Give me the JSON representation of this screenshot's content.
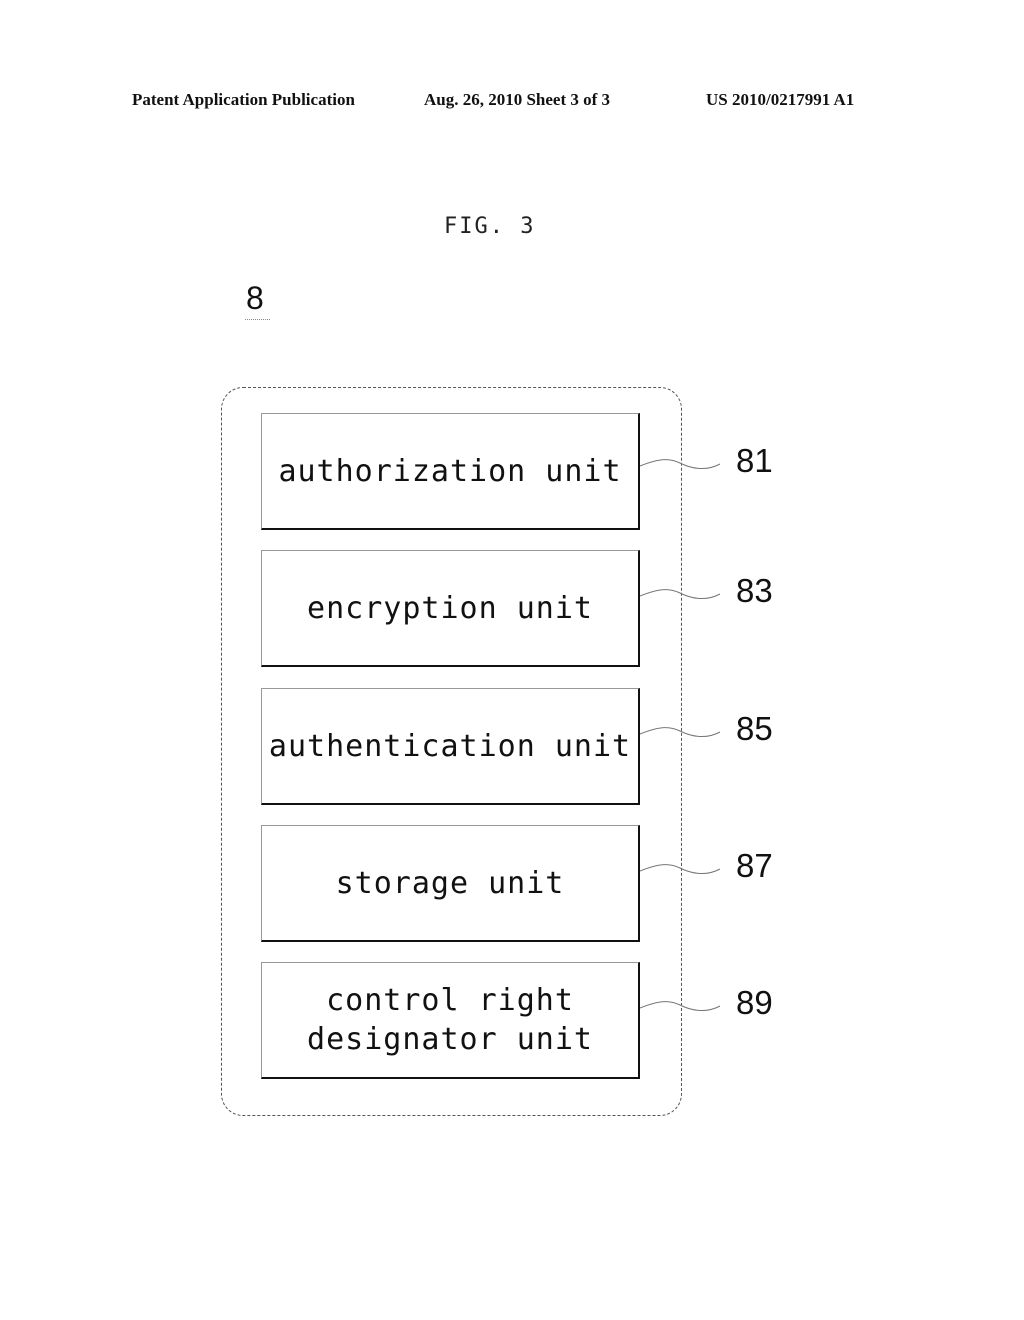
{
  "header": {
    "left": "Patent Application Publication",
    "middle": "Aug. 26, 2010  Sheet 3 of 3",
    "right": "US 2010/0217991 A1"
  },
  "figure": {
    "title": "FIG. 3",
    "reference_numeral": "8",
    "units": [
      {
        "label": "authorization unit",
        "ref": "81"
      },
      {
        "label": "encryption unit",
        "ref": "83"
      },
      {
        "label": "authentication unit",
        "ref": "85"
      },
      {
        "label": "storage unit",
        "ref": "87"
      },
      {
        "label": "control right designator unit",
        "ref": "89",
        "lines": [
          "control right",
          "designator unit"
        ]
      }
    ]
  }
}
